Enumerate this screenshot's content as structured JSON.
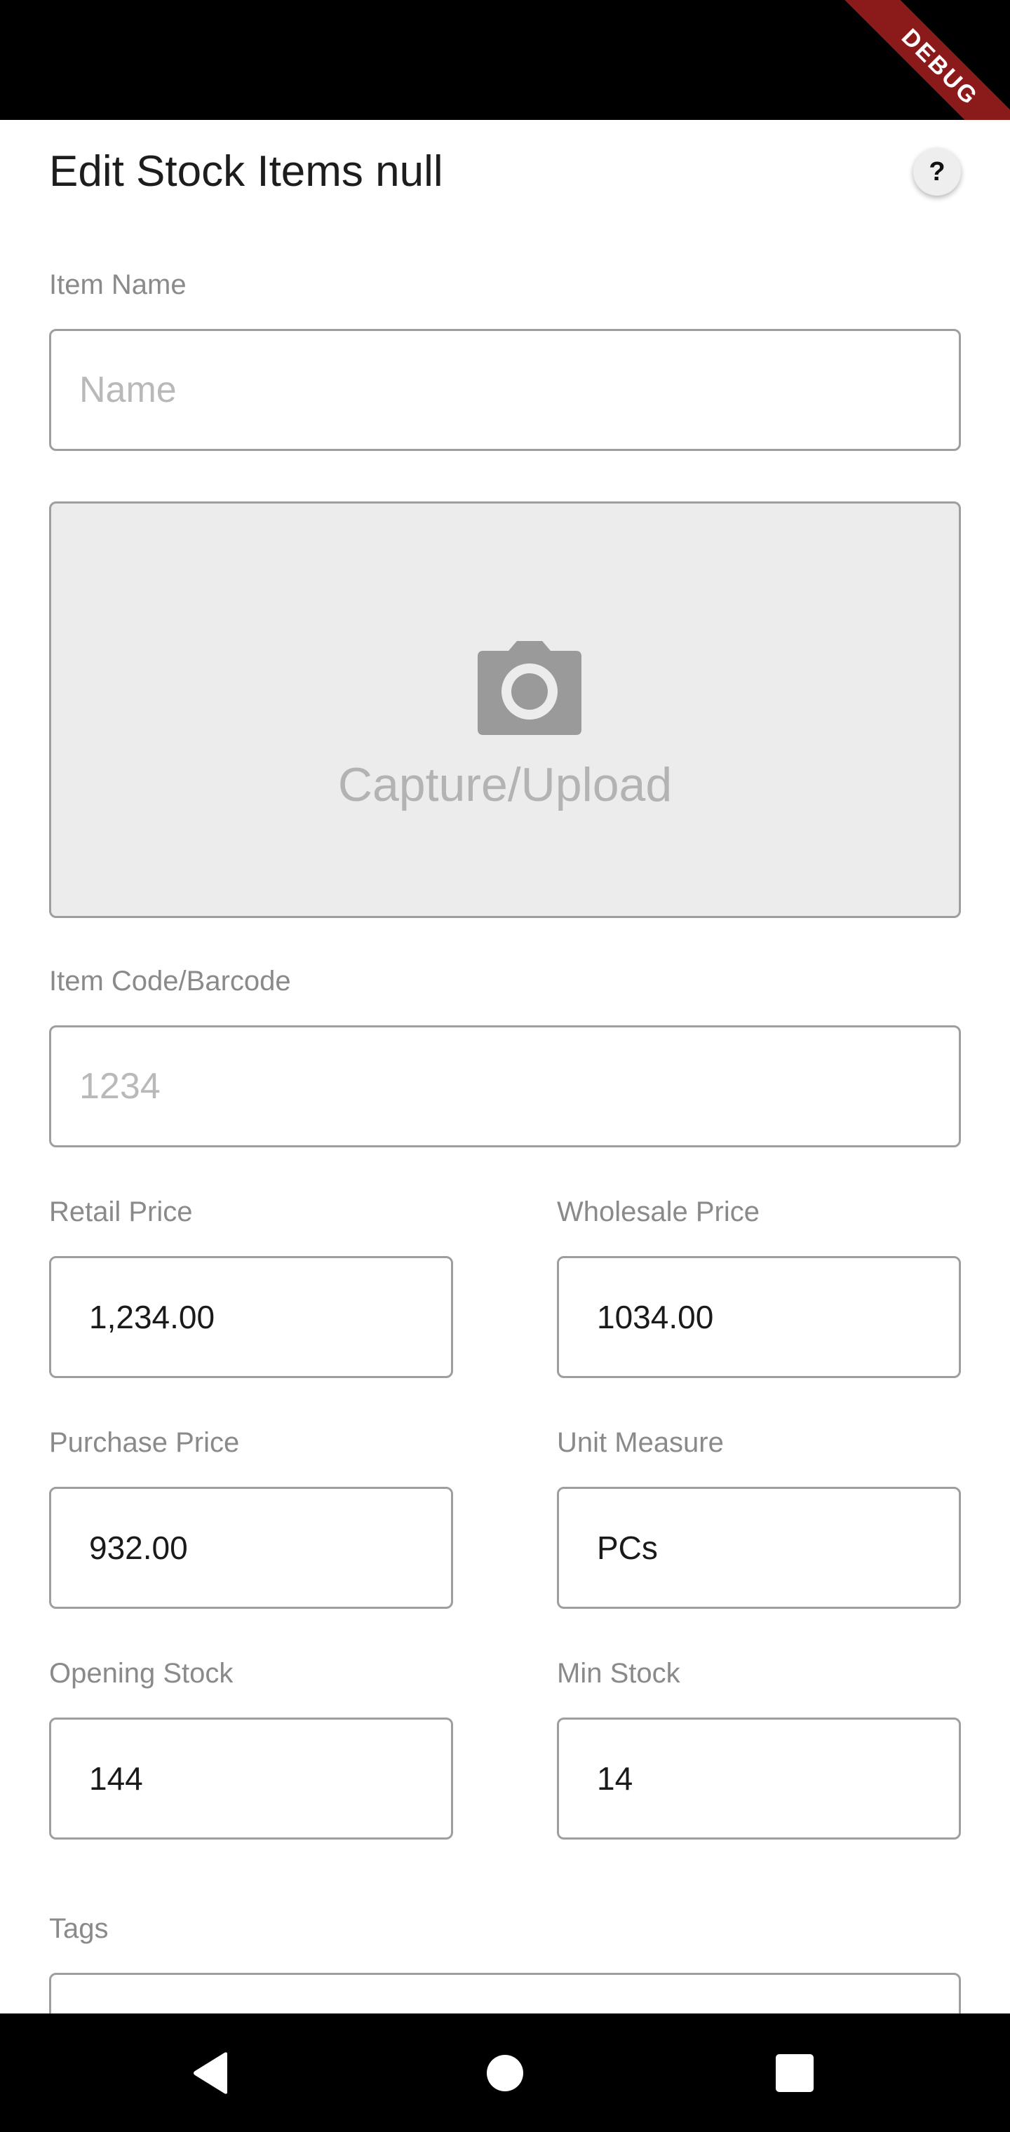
{
  "status_bar": {
    "debug_label": "DEBUG"
  },
  "header": {
    "title": "Edit Stock Items null",
    "help_label": "?"
  },
  "form": {
    "item_name": {
      "label": "Item Name",
      "placeholder": "Name",
      "value": ""
    },
    "image_upload": {
      "label": "Capture/Upload",
      "icon": "camera-icon"
    },
    "item_code": {
      "label": "Item Code/Barcode",
      "placeholder": "1234",
      "value": ""
    },
    "retail_price": {
      "label": "Retail Price",
      "value": "1,234.00"
    },
    "wholesale_price": {
      "label": "Wholesale Price",
      "value": "1034.00"
    },
    "purchase_price": {
      "label": "Purchase Price",
      "value": "932.00"
    },
    "unit_measure": {
      "label": "Unit Measure",
      "value": "PCs"
    },
    "opening_stock": {
      "label": "Opening Stock",
      "value": "144"
    },
    "min_stock": {
      "label": "Min Stock",
      "value": "14"
    },
    "tags": {
      "label": "Tags",
      "value": ""
    }
  },
  "nav_bar": {
    "back_icon": "back-triangle-icon",
    "home_icon": "home-circle-icon",
    "recents_icon": "recents-square-icon"
  }
}
